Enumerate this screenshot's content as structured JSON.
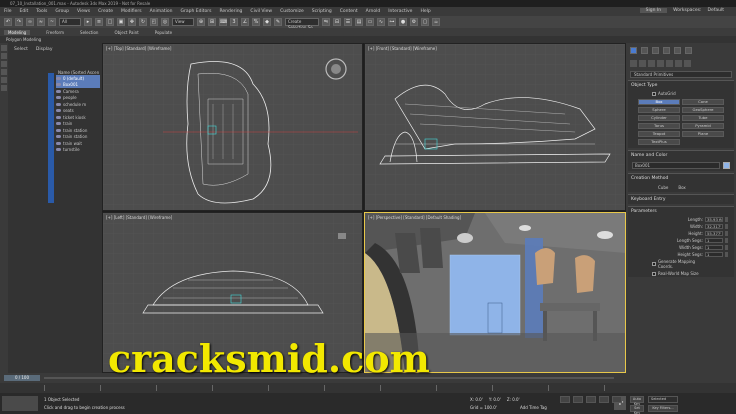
{
  "window": {
    "title": "07_10_Installation_001.max - Autodesk 3ds Max 2019 - Not for Resale",
    "sign_in": "Sign In",
    "workspace_label": "Workspaces:",
    "workspace_value": "Default"
  },
  "menubar": [
    "File",
    "Edit",
    "Tools",
    "Group",
    "Views",
    "Create",
    "Modifiers",
    "Animation",
    "Graph Editors",
    "Rendering",
    "Civil View",
    "Customize",
    "Scripting",
    "Content",
    "Arnold",
    "Interactive",
    "Help"
  ],
  "toolbar": {
    "selection_filter": "All",
    "view_dropdown": "View",
    "selection_set": "Create Selection Se"
  },
  "ribbon": {
    "tabs": [
      "Modeling",
      "Freeform",
      "Selection",
      "Object Paint",
      "Populate"
    ],
    "active": "Modeling"
  },
  "poly_label": "Polygon Modeling",
  "explorer": {
    "tabs": [
      "Select",
      "Display"
    ],
    "header": "Name (Sorted Ascen",
    "items": [
      "0 (default)",
      "Box001",
      "Camera",
      "people",
      "schedule m",
      "seats",
      "ticket kiosk",
      "train",
      "train station",
      "train station",
      "train wait",
      "turnstile"
    ]
  },
  "viewports": {
    "top": "[+] [Top] [Standard] [Wireframe]",
    "front": "[+] [Front] [Standard] [Wireframe]",
    "left": "[+] [Left] [Standard] [Wireframe]",
    "perspective": "[+] [Perspective] [Standard] [Default Shading]"
  },
  "command_panel": {
    "category": "Standard Primitives",
    "object_type_title": "Object Type",
    "autogrid": "AutoGrid",
    "buttons": [
      "Box",
      "Cone",
      "Sphere",
      "GeoSphere",
      "Cylinder",
      "Tube",
      "Torus",
      "Pyramid",
      "Teapot",
      "Plane",
      "TextPlus"
    ],
    "active_button": "Box",
    "name_color_title": "Name and Color",
    "name_value": "Box001",
    "creation_method_title": "Creation Method",
    "creation_options": [
      "Cube",
      "Box"
    ],
    "keyboard_entry_title": "Keyboard Entry",
    "parameters_title": "Parameters",
    "params": [
      {
        "label": "Length:",
        "value": "35.93 ft"
      },
      {
        "label": "Width:",
        "value": "32.317'"
      },
      {
        "label": "Height:",
        "value": "55.377'"
      },
      {
        "label": "Length Segs:",
        "value": "1"
      },
      {
        "label": "Width Segs:",
        "value": "1"
      },
      {
        "label": "Height Segs:",
        "value": "1"
      }
    ],
    "gen_mapping": "Generate Mapping Coords.",
    "real_world": "Real-World Map Size"
  },
  "timeline": {
    "slider": "0 / 100"
  },
  "status": {
    "selected": "1 Object Selected",
    "prompt": "Click and drag to begin creation process",
    "x": "X: 0.0'",
    "y": "Y: 0.0'",
    "z": "Z: 0.0'",
    "grid": "Grid = 100.0'",
    "add_time_tag": "Add Time Tag",
    "auto_key": "Auto Key",
    "selected_dd": "Selected",
    "set_key": "Set Key",
    "key_filters": "Key Filters..."
  },
  "watermark": "cracksmid.com",
  "colors": {
    "accent": "#5b7cba",
    "active_viewport_border": "#e8c84a",
    "watermark": "#f2e800"
  }
}
